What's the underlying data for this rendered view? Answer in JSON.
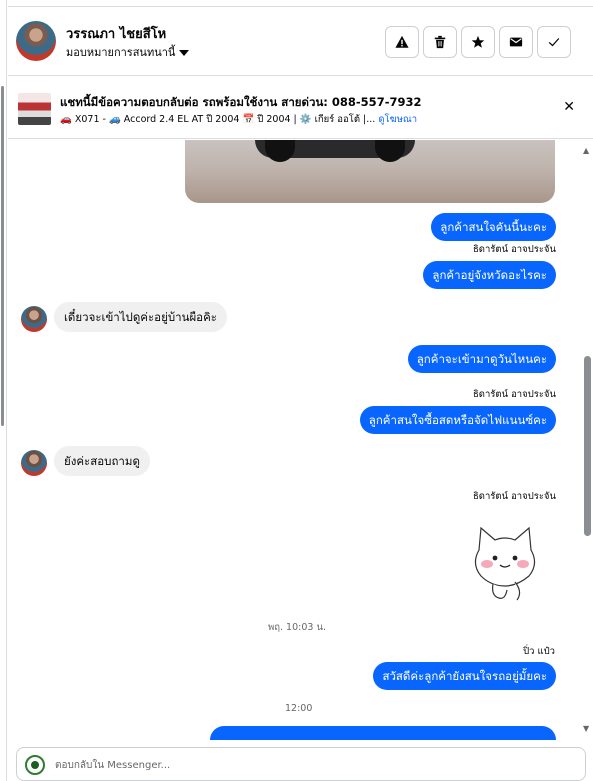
{
  "header": {
    "contact_name": "วรรณภา ไชยสีโห",
    "assign_label": "มอบหมายการสนทนานี้",
    "actions": [
      "report-icon",
      "trash-icon",
      "star-icon",
      "mail-icon",
      "check-icon"
    ]
  },
  "ad": {
    "title": "แชทนี้มีข้อความตอบกลับต่อ รถพร้อมใช้งาน สายด่วน: 088-557-7932",
    "details": "🚗 X071 - 🚙 Accord 2.4 EL AT ปี 2004 📅 ปี 2004 | ⚙️ เกียร์ ออโต้ |...",
    "view_ad_link": "ดูโฆษณา"
  },
  "messages": {
    "m1": "ลูกค้าสนใจคันนี้นะคะ",
    "sender1": "ธิดารัตน์ อาจประจัน",
    "m2": "ลูกค้าอยู่จังหวัดอะไรคะ",
    "m3": "เดี๋ยวจะเข้าไปดูค่ะอยู่บ้านผือคิะ",
    "m4": "ลูกค้าจะเข้ามาดูวันไหนคะ",
    "sender2": "ธิดารัตน์ อาจประจัน",
    "m5": "ลูกค้าสนใจซื้อสดหรือจัดไฟแนนซ์คะ",
    "m6": "ยังค่ะสอบถามดู",
    "sender3": "ธิดารัตน์ อาจประจัน",
    "time1": "พฤ. 10:03 น.",
    "sender4": "ปิ่ว แป๋ว",
    "m7": "สวัสดีค่ะลูกค้ายังสนใจรถอยู่มั้ยคะ",
    "time2": "12:00"
  },
  "composer": {
    "placeholder": "ตอบกลับใน Messenger..."
  },
  "colors": {
    "accent": "#0866ff",
    "incoming_bubble": "#f0f0f0"
  }
}
